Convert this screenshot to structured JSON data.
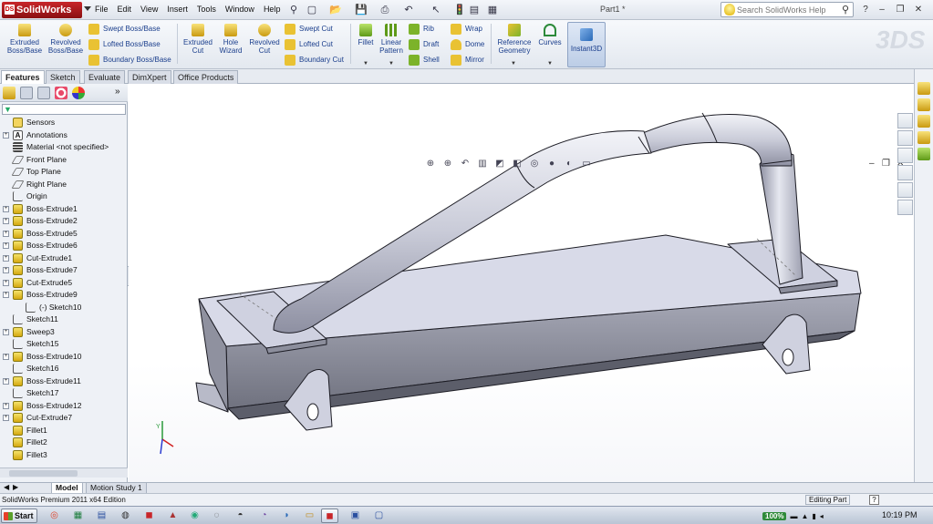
{
  "titlebar": {
    "app_name": "SolidWorks",
    "menus": [
      "File",
      "Edit",
      "View",
      "Insert",
      "Tools",
      "Window",
      "Help"
    ],
    "document_title": "Part1 *",
    "search_placeholder": "Search SolidWorks Help"
  },
  "command_manager": {
    "extruded_boss": "Extruded Boss/Base",
    "revolved_boss": "Revolved Boss/Base",
    "swept_boss": "Swept Boss/Base",
    "lofted_boss": "Lofted Boss/Base",
    "boundary_boss": "Boundary Boss/Base",
    "extruded_cut": "Extruded Cut",
    "hole_wizard": "Hole Wizard",
    "revolved_cut": "Revolved Cut",
    "swept_cut": "Swept Cut",
    "lofted_cut": "Lofted Cut",
    "boundary_cut": "Boundary Cut",
    "fillet": "Fillet",
    "linear_pattern": "Linear Pattern",
    "rib": "Rib",
    "draft": "Draft",
    "shell": "Shell",
    "wrap": "Wrap",
    "dome": "Dome",
    "mirror": "Mirror",
    "reference_geometry": "Reference Geometry",
    "curves": "Curves",
    "instant3d": "Instant3D"
  },
  "tabs": [
    "Features",
    "Sketch",
    "Evaluate",
    "DimXpert",
    "Office Products"
  ],
  "feature_tree": [
    {
      "label": "Sensors",
      "icon": "sensor",
      "expand": false
    },
    {
      "label": "Annotations",
      "icon": "annot",
      "expand": true
    },
    {
      "label": "Material <not specified>",
      "icon": "mat",
      "expand": false
    },
    {
      "label": "Front Plane",
      "icon": "plane",
      "expand": false
    },
    {
      "label": "Top Plane",
      "icon": "plane",
      "expand": false
    },
    {
      "label": "Right Plane",
      "icon": "plane",
      "expand": false
    },
    {
      "label": "Origin",
      "icon": "origin",
      "expand": false
    },
    {
      "label": "Boss-Extrude1",
      "icon": "feat",
      "expand": true
    },
    {
      "label": "Boss-Extrude2",
      "icon": "feat",
      "expand": true
    },
    {
      "label": "Boss-Extrude5",
      "icon": "feat",
      "expand": true
    },
    {
      "label": "Boss-Extrude6",
      "icon": "feat",
      "expand": true
    },
    {
      "label": "Cut-Extrude1",
      "icon": "feat",
      "expand": true
    },
    {
      "label": "Boss-Extrude7",
      "icon": "feat",
      "expand": true
    },
    {
      "label": "Cut-Extrude5",
      "icon": "feat",
      "expand": true
    },
    {
      "label": "Boss-Extrude9",
      "icon": "feat",
      "expand": true
    },
    {
      "label": "(-) Sketch10",
      "icon": "sketch",
      "expand": false,
      "indent": true
    },
    {
      "label": "Sketch11",
      "icon": "sketch",
      "expand": false
    },
    {
      "label": "Sweep3",
      "icon": "feat",
      "expand": true
    },
    {
      "label": "Sketch15",
      "icon": "sketch",
      "expand": false
    },
    {
      "label": "Boss-Extrude10",
      "icon": "feat",
      "expand": true
    },
    {
      "label": "Sketch16",
      "icon": "sketch",
      "expand": false
    },
    {
      "label": "Boss-Extrude11",
      "icon": "feat",
      "expand": true
    },
    {
      "label": "Sketch17",
      "icon": "sketch",
      "expand": false
    },
    {
      "label": "Boss-Extrude12",
      "icon": "feat",
      "expand": true
    },
    {
      "label": "Cut-Extrude7",
      "icon": "feat",
      "expand": true
    },
    {
      "label": "Fillet1",
      "icon": "feat",
      "expand": false
    },
    {
      "label": "Fillet2",
      "icon": "feat",
      "expand": false
    },
    {
      "label": "Fillet3",
      "icon": "feat",
      "expand": false
    }
  ],
  "bottom_tabs": [
    "Model",
    "Motion Study 1"
  ],
  "status": {
    "edition": "SolidWorks Premium 2011 x64 Edition",
    "mode": "Editing Part",
    "help": "?"
  },
  "taskbar": {
    "start": "Start",
    "zoom": "100%",
    "clock": "10:19 PM"
  },
  "colors": {
    "accent": "#1a3e8c",
    "model_face": "#d6d8e6",
    "model_edge": "#1c1c24",
    "brand_red": "#c8262a"
  }
}
